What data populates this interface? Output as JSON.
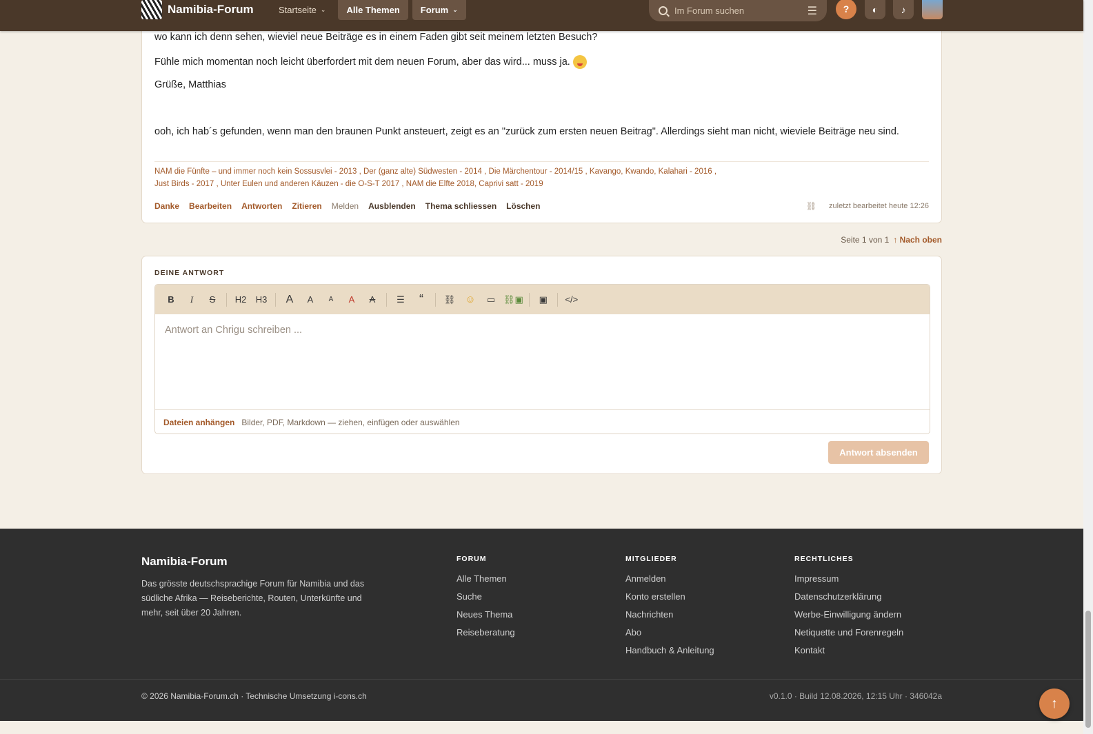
{
  "header": {
    "site_name": "Namibia-Forum",
    "nav": [
      {
        "label": "Startseite"
      },
      {
        "label": "Alle Themen"
      },
      {
        "label": "Forum"
      }
    ],
    "search_placeholder": "Im Forum suchen",
    "help_label": "?"
  },
  "post": {
    "line1": "wo kann ich denn sehen, wieviel neue Beiträge es in einem Faden gibt seit meinem letzten Besuch?",
    "line2": "Fühle mich momentan noch leicht überfordert mit dem neuen Forum, aber das wird... muss ja.",
    "line3": "Grüße, Matthias",
    "line4": "ooh, ich hab´s gefunden, wenn man den braunen Punkt ansteuert, zeigt es an \"zurück zum ersten neuen Beitrag\". Allerdings sieht man nicht, wieviele Beiträge neu sind.",
    "signature_line1": "NAM die Fünfte – und immer noch kein Sossusvlei  - 2013 , Der (ganz alte) Südwesten - 2014 , Die Märchentour - 2014/15 , Kavango, Kwando, Kalahari - 2016 ,",
    "signature_line2": " Just Birds - 2017 , Unter Eulen und anderen Käuzen - die O-S-T 2017 , NAM die Elfte 2018, Caprivi satt - 2019",
    "actions": {
      "thanks": "Danke",
      "edit": "Bearbeiten",
      "reply": "Antworten",
      "quote": "Zitieren",
      "report": "Melden",
      "hide": "Ausblenden",
      "close_topic": "Thema schliessen",
      "delete": "Löschen"
    },
    "edited": "zuletzt bearbeitet heute 12:26"
  },
  "pager": {
    "page_info": "Seite 1 von 1",
    "to_top": "↑ Nach oben"
  },
  "reply": {
    "title": "DEINE ANTWORT",
    "toolbar": {
      "bold": "B",
      "italic": "I",
      "strike": "S",
      "h2": "H2",
      "h3": "H3",
      "size_large": "A",
      "size_medium": "A",
      "size_small": "A",
      "color": "A",
      "clear_format": "A",
      "list": "☰",
      "quote": "“",
      "link": "⛓",
      "emoji": "☺",
      "video": "▭",
      "image_link": "⛓▣",
      "image": "▣",
      "code": "</>"
    },
    "placeholder": "Antwort an Chrigu schreiben ...",
    "attach_label": "Dateien anhängen",
    "attach_hint": "Bilder, PDF, Markdown — ziehen, einfügen oder auswählen",
    "submit": "Antwort absenden"
  },
  "footer": {
    "brand": "Namibia-Forum",
    "description": "Das grösste deutschsprachige Forum für Namibia und das südliche Afrika — Reiseberichte, Routen, Unterkünfte und mehr, seit über 20 Jahren.",
    "columns": [
      {
        "title": "FORUM",
        "links": [
          "Alle Themen",
          "Suche",
          "Neues Thema",
          "Reiseberatung"
        ]
      },
      {
        "title": "MITGLIEDER",
        "links": [
          "Anmelden",
          "Konto erstellen",
          "Nachrichten",
          "Abo",
          "Handbuch & Anleitung"
        ]
      },
      {
        "title": "RECHTLICHES",
        "links": [
          "Impressum",
          "Datenschutzerklärung",
          "Werbe-Einwilligung ändern",
          "Netiquette und Forenregeln",
          "Kontakt"
        ]
      }
    ],
    "copyright": "© 2026 Namibia-Forum.ch · Technische Umsetzung i-cons.ch",
    "version": "v0.1.0 · Build 12.08.2026, 12:15 Uhr · 346042a"
  },
  "colors": {
    "brand_dark": "#4a3829",
    "accent": "#d8824a",
    "link": "#a35a2a"
  }
}
